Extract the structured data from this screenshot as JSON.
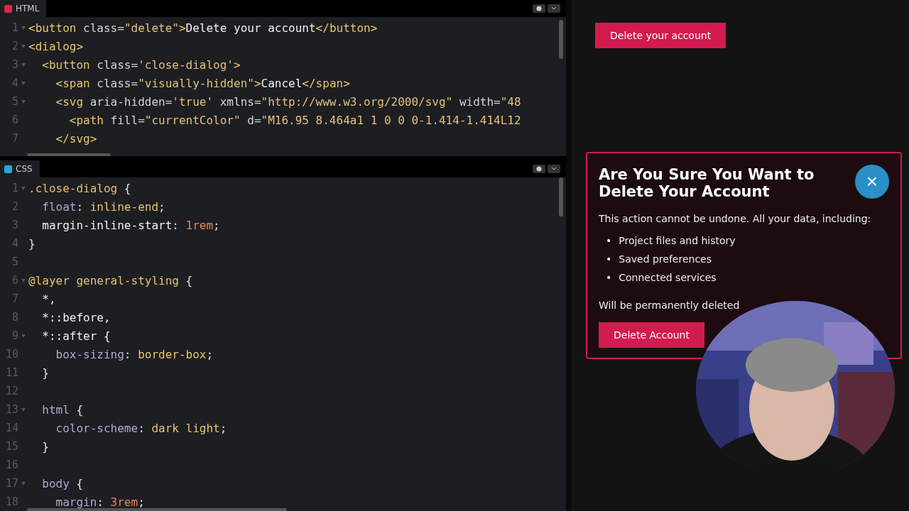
{
  "editors": [
    {
      "kind": "html",
      "tab": "HTML",
      "lines": [
        {
          "number": "1",
          "foldable": true,
          "tokens": [
            {
              "kind": "tag",
              "text": "<button"
            },
            {
              "kind": "attr",
              "text": " class="
            },
            {
              "kind": "str",
              "text": "\"delete\""
            },
            {
              "kind": "tag",
              "text": ">"
            },
            {
              "kind": "text",
              "text": "Delete your account"
            },
            {
              "kind": "tag",
              "text": "</button>"
            }
          ]
        },
        {
          "number": "2",
          "foldable": true,
          "tokens": [
            {
              "kind": "tag",
              "text": "<dialog>"
            }
          ]
        },
        {
          "number": "3",
          "foldable": true,
          "tokens": [
            {
              "kind": "tag",
              "text": "  <button"
            },
            {
              "kind": "attr",
              "text": " class="
            },
            {
              "kind": "str",
              "text": "'close-dialog'"
            },
            {
              "kind": "tag",
              "text": ">"
            }
          ]
        },
        {
          "number": "4",
          "foldable": true,
          "tokens": [
            {
              "kind": "tag",
              "text": "    <span"
            },
            {
              "kind": "attr",
              "text": " class="
            },
            {
              "kind": "str",
              "text": "\"visually-hidden\""
            },
            {
              "kind": "tag",
              "text": ">"
            },
            {
              "kind": "text",
              "text": "Cancel"
            },
            {
              "kind": "tag",
              "text": "</span>"
            }
          ]
        },
        {
          "number": "5",
          "foldable": true,
          "tokens": [
            {
              "kind": "tag",
              "text": "    <svg"
            },
            {
              "kind": "attr",
              "text": " aria-hidden="
            },
            {
              "kind": "str",
              "text": "'true'"
            },
            {
              "kind": "attr",
              "text": " xmlns="
            },
            {
              "kind": "str",
              "text": "\"http://www.w3.org/2000/svg\""
            },
            {
              "kind": "attr",
              "text": " width="
            },
            {
              "kind": "str",
              "text": "\"48"
            }
          ]
        },
        {
          "number": "6",
          "foldable": false,
          "tokens": [
            {
              "kind": "tag",
              "text": "      <path"
            },
            {
              "kind": "attr",
              "text": " fill="
            },
            {
              "kind": "str",
              "text": "\"currentColor\""
            },
            {
              "kind": "attr",
              "text": " d="
            },
            {
              "kind": "str",
              "text": "\"M16.95 8.464a1 1 0 0 0-1.414-1.414L12"
            }
          ]
        },
        {
          "number": "7",
          "foldable": false,
          "tokens": [
            {
              "kind": "tag",
              "text": "    </svg>"
            }
          ]
        }
      ]
    },
    {
      "kind": "css",
      "tab": "CSS",
      "lines": [
        {
          "number": "1",
          "foldable": true,
          "tokens": [
            {
              "kind": "sel",
              "text": ".close-dialog"
            },
            {
              "kind": "punct",
              "text": " {"
            }
          ]
        },
        {
          "number": "2",
          "foldable": false,
          "tokens": [
            {
              "kind": "prop",
              "text": "  float"
            },
            {
              "kind": "punct",
              "text": ": "
            },
            {
              "kind": "val",
              "text": "inline-end"
            },
            {
              "kind": "punct",
              "text": ";"
            }
          ]
        },
        {
          "number": "3",
          "foldable": false,
          "tokens": [
            {
              "kind": "text",
              "text": "  margin-inline-start"
            },
            {
              "kind": "punct",
              "text": ": "
            },
            {
              "kind": "num",
              "text": "1rem"
            },
            {
              "kind": "punct",
              "text": ";"
            }
          ]
        },
        {
          "number": "4",
          "foldable": false,
          "tokens": [
            {
              "kind": "punct",
              "text": "}"
            }
          ]
        },
        {
          "number": "5",
          "foldable": false
        },
        {
          "number": "6",
          "foldable": true,
          "tokens": [
            {
              "kind": "sel",
              "text": "@layer general-styling"
            },
            {
              "kind": "punct",
              "text": " {"
            }
          ]
        },
        {
          "number": "7",
          "foldable": false,
          "tokens": [
            {
              "kind": "text",
              "text": "  *,"
            }
          ]
        },
        {
          "number": "8",
          "foldable": false,
          "tokens": [
            {
              "kind": "text",
              "text": "  *::before,"
            }
          ]
        },
        {
          "number": "9",
          "foldable": true,
          "tokens": [
            {
              "kind": "text",
              "text": "  *::after {"
            }
          ]
        },
        {
          "number": "10",
          "foldable": false,
          "tokens": [
            {
              "kind": "prop",
              "text": "    box-sizing"
            },
            {
              "kind": "punct",
              "text": ": "
            },
            {
              "kind": "val",
              "text": "border-box"
            },
            {
              "kind": "punct",
              "text": ";"
            }
          ]
        },
        {
          "number": "11",
          "foldable": false,
          "tokens": [
            {
              "kind": "punct",
              "text": "  }"
            }
          ]
        },
        {
          "number": "12",
          "foldable": false
        },
        {
          "number": "13",
          "foldable": true,
          "tokens": [
            {
              "kind": "prop",
              "text": "  html"
            },
            {
              "kind": "punct",
              "text": " {"
            }
          ]
        },
        {
          "number": "14",
          "foldable": false,
          "tokens": [
            {
              "kind": "prop",
              "text": "    color-scheme"
            },
            {
              "kind": "punct",
              "text": ": "
            },
            {
              "kind": "val",
              "text": "dark light"
            },
            {
              "kind": "punct",
              "text": ";"
            }
          ]
        },
        {
          "number": "15",
          "foldable": false,
          "tokens": [
            {
              "kind": "punct",
              "text": "  }"
            }
          ]
        },
        {
          "number": "16",
          "foldable": false
        },
        {
          "number": "17",
          "foldable": true,
          "tokens": [
            {
              "kind": "prop",
              "text": "  body"
            },
            {
              "kind": "punct",
              "text": " {"
            }
          ]
        },
        {
          "number": "18",
          "foldable": false,
          "tokens": [
            {
              "kind": "prop",
              "text": "    margin"
            },
            {
              "kind": "punct",
              "text": ": "
            },
            {
              "kind": "num",
              "text": "3rem"
            },
            {
              "kind": "punct",
              "text": ";"
            }
          ]
        }
      ]
    }
  ],
  "preview": {
    "open_button": "Delete your account",
    "dialog": {
      "title": "Are You Sure You Want to Delete Your Account",
      "close": "×",
      "intro": "This action cannot be undone. All your data, including:",
      "bullet": "•",
      "items": [
        "Project files and history",
        "Saved preferences",
        "Connected services"
      ],
      "outro": "Will be permanently deleted",
      "confirm": "Delete Account"
    }
  }
}
